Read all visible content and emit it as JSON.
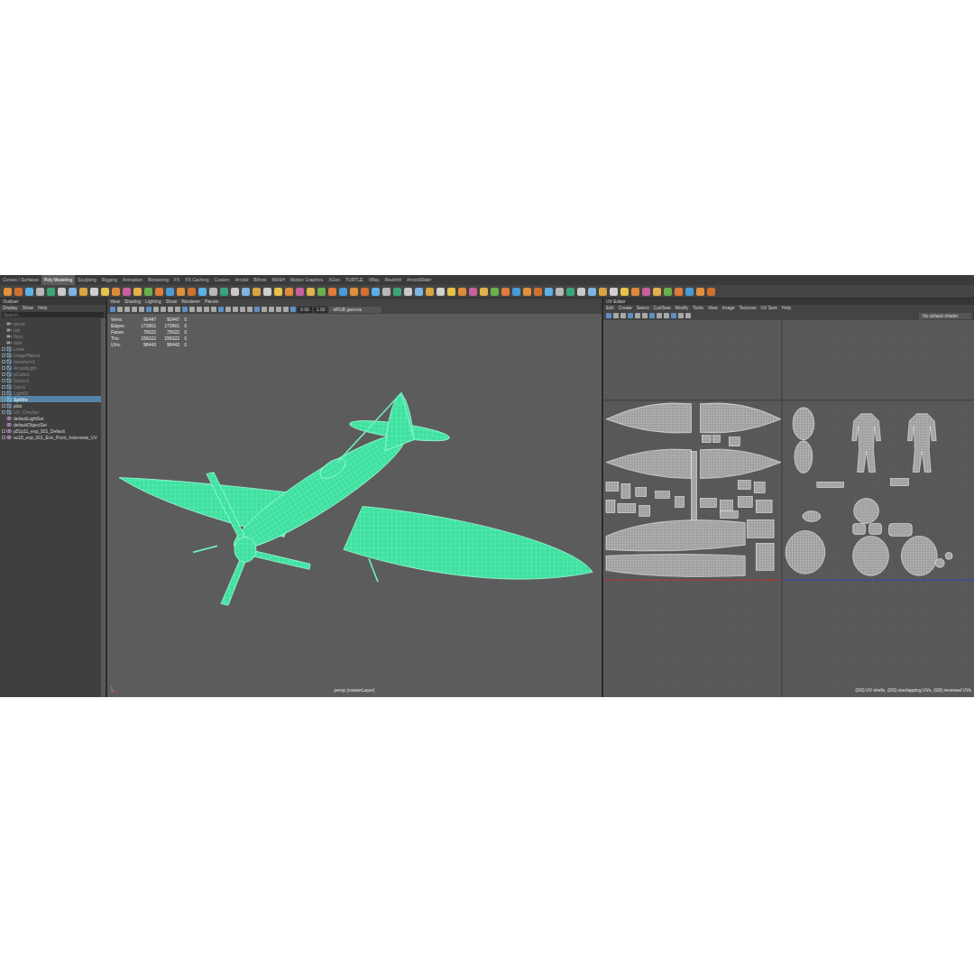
{
  "shelf": {
    "tabs": [
      {
        "label": "Curves / Surfaces",
        "selected": false
      },
      {
        "label": "Poly Modeling",
        "selected": true
      },
      {
        "label": "Sculpting",
        "selected": false
      },
      {
        "label": "Rigging",
        "selected": false
      },
      {
        "label": "Animation",
        "selected": false
      },
      {
        "label": "Rendering",
        "selected": false
      },
      {
        "label": "FX",
        "selected": false
      },
      {
        "label": "FX Caching",
        "selected": false
      },
      {
        "label": "Custom",
        "selected": false
      },
      {
        "label": "Arnold",
        "selected": false
      },
      {
        "label": "Bifrost",
        "selected": false
      },
      {
        "label": "MASH",
        "selected": false
      },
      {
        "label": "Motion Graphics",
        "selected": false
      },
      {
        "label": "XGen",
        "selected": false
      },
      {
        "label": "TURTLE",
        "selected": false
      },
      {
        "label": "VRay",
        "selected": false
      },
      {
        "label": "Redshift",
        "selected": false
      },
      {
        "label": "ArnoldSlider",
        "selected": false
      }
    ]
  },
  "outliner": {
    "title": "Outliner",
    "menu": [
      "Display",
      "Show",
      "Help"
    ],
    "search": {
      "placeholder": "Search..."
    },
    "items": [
      {
        "label": "persp",
        "kind": "camera",
        "expandable": false,
        "dimmed": true,
        "selected": false
      },
      {
        "label": "top",
        "kind": "camera",
        "expandable": false,
        "dimmed": true,
        "selected": false
      },
      {
        "label": "front",
        "kind": "camera",
        "expandable": false,
        "dimmed": true,
        "selected": false
      },
      {
        "label": "side",
        "kind": "camera",
        "expandable": false,
        "dimmed": true,
        "selected": false
      },
      {
        "label": "Lines",
        "kind": "mesh",
        "expandable": true,
        "dimmed": true,
        "selected": false
      },
      {
        "label": "ImagePlane1",
        "kind": "mesh",
        "expandable": true,
        "dimmed": true,
        "selected": false
      },
      {
        "label": "transform1",
        "kind": "mesh",
        "expandable": true,
        "dimmed": true,
        "selected": false
      },
      {
        "label": "ArnoldLight",
        "kind": "mesh",
        "expandable": true,
        "dimmed": true,
        "selected": false
      },
      {
        "label": "pCube1",
        "kind": "mesh",
        "expandable": true,
        "dimmed": true,
        "selected": false
      },
      {
        "label": "Ground",
        "kind": "mesh",
        "expandable": true,
        "dimmed": true,
        "selected": false
      },
      {
        "label": "Cam1",
        "kind": "mesh",
        "expandable": true,
        "dimmed": true,
        "selected": false
      },
      {
        "label": "Light01",
        "kind": "mesh",
        "expandable": true,
        "dimmed": true,
        "selected": false
      },
      {
        "label": "Spitfire",
        "kind": "mesh",
        "expandable": true,
        "dimmed": false,
        "selected": true
      },
      {
        "label": "pilot",
        "kind": "mesh",
        "expandable": true,
        "dimmed": false,
        "selected": false
      },
      {
        "label": "UV_Checker",
        "kind": "mesh",
        "expandable": true,
        "dimmed": true,
        "selected": false
      },
      {
        "label": "defaultLightSet",
        "kind": "set",
        "expandable": false,
        "dimmed": false,
        "selected": false
      },
      {
        "label": "defaultObjectSet",
        "kind": "set",
        "expandable": false,
        "dimmed": false,
        "selected": false
      },
      {
        "label": "p51p11_exp_001_Default",
        "kind": "set",
        "expandable": true,
        "dimmed": false,
        "selected": false
      },
      {
        "label": "su15_exp_001_Exit_Front_Indonesia_UV",
        "kind": "set",
        "expandable": true,
        "dimmed": false,
        "selected": false
      }
    ]
  },
  "viewport": {
    "menu": [
      "View",
      "Shading",
      "Lighting",
      "Show",
      "Renderer",
      "Panels"
    ],
    "fields": [
      "0.00",
      "1.00"
    ],
    "colorspace": "sRGB gamma",
    "hud": [
      {
        "label": "Verts:",
        "values": [
          "90447",
          "90447",
          "0"
        ]
      },
      {
        "label": "Edges:",
        "values": [
          "173801",
          "173801",
          "0"
        ]
      },
      {
        "label": "Faces:",
        "values": [
          "79022",
          "79022",
          "0"
        ]
      },
      {
        "label": "Tris:",
        "values": [
          "156022",
          "156022",
          "0"
        ]
      },
      {
        "label": "UVs:",
        "values": [
          "98443",
          "98443",
          "0"
        ]
      }
    ],
    "camera_label": "persp (masterLayer)"
  },
  "uv_editor": {
    "title": "UV Editor",
    "menu": [
      "Edit",
      "Create",
      "Select",
      "Cut/Sew",
      "Modify",
      "Tools",
      "View",
      "Image",
      "Textures",
      "UV Sets",
      "Help"
    ],
    "shader": "No default shader",
    "status": "(0/0) UV shells, (0/0) overlapping UVs, (0/0) reversed UVs"
  }
}
